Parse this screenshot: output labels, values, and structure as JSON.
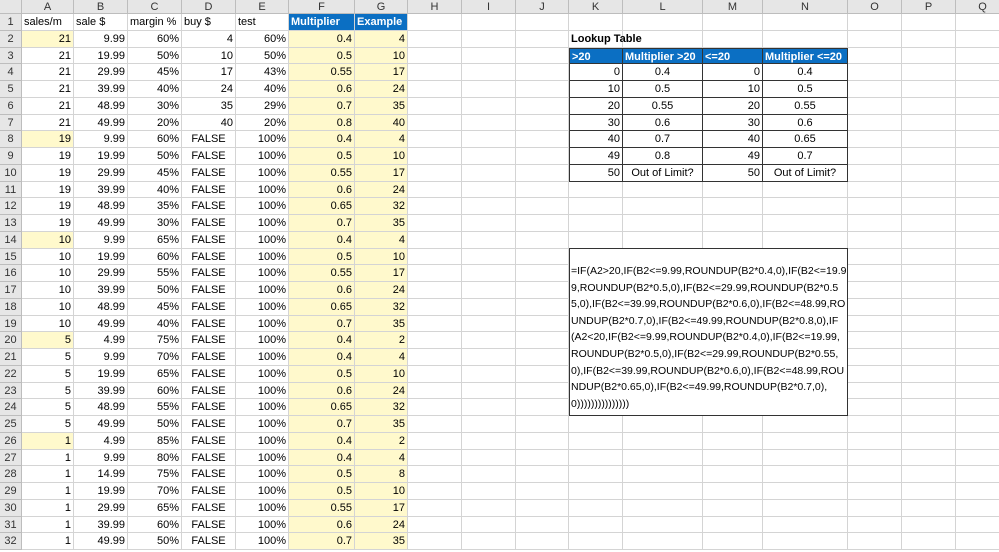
{
  "columns": [
    "A",
    "B",
    "C",
    "D",
    "E",
    "F",
    "G",
    "H",
    "I",
    "J",
    "K",
    "L",
    "M",
    "N",
    "O",
    "P",
    "Q"
  ],
  "headers": [
    "sales/m",
    "sale $",
    "margin %",
    "buy $",
    "test",
    "Multiplier",
    "Example"
  ],
  "rows": [
    [
      "21",
      "9.99",
      "60%",
      "4",
      "60%",
      "0.4",
      "4"
    ],
    [
      "21",
      "19.99",
      "50%",
      "10",
      "50%",
      "0.5",
      "10"
    ],
    [
      "21",
      "29.99",
      "45%",
      "17",
      "43%",
      "0.55",
      "17"
    ],
    [
      "21",
      "39.99",
      "40%",
      "24",
      "40%",
      "0.6",
      "24"
    ],
    [
      "21",
      "48.99",
      "30%",
      "35",
      "29%",
      "0.7",
      "35"
    ],
    [
      "21",
      "49.99",
      "20%",
      "40",
      "20%",
      "0.8",
      "40"
    ],
    [
      "19",
      "9.99",
      "60%",
      "FALSE",
      "100%",
      "0.4",
      "4"
    ],
    [
      "19",
      "19.99",
      "50%",
      "FALSE",
      "100%",
      "0.5",
      "10"
    ],
    [
      "19",
      "29.99",
      "45%",
      "FALSE",
      "100%",
      "0.55",
      "17"
    ],
    [
      "19",
      "39.99",
      "40%",
      "FALSE",
      "100%",
      "0.6",
      "24"
    ],
    [
      "19",
      "48.99",
      "35%",
      "FALSE",
      "100%",
      "0.65",
      "32"
    ],
    [
      "19",
      "49.99",
      "30%",
      "FALSE",
      "100%",
      "0.7",
      "35"
    ],
    [
      "10",
      "9.99",
      "65%",
      "FALSE",
      "100%",
      "0.4",
      "4"
    ],
    [
      "10",
      "19.99",
      "60%",
      "FALSE",
      "100%",
      "0.5",
      "10"
    ],
    [
      "10",
      "29.99",
      "55%",
      "FALSE",
      "100%",
      "0.55",
      "17"
    ],
    [
      "10",
      "39.99",
      "50%",
      "FALSE",
      "100%",
      "0.6",
      "24"
    ],
    [
      "10",
      "48.99",
      "45%",
      "FALSE",
      "100%",
      "0.65",
      "32"
    ],
    [
      "10",
      "49.99",
      "40%",
      "FALSE",
      "100%",
      "0.7",
      "35"
    ],
    [
      "5",
      "4.99",
      "75%",
      "FALSE",
      "100%",
      "0.4",
      "2"
    ],
    [
      "5",
      "9.99",
      "70%",
      "FALSE",
      "100%",
      "0.4",
      "4"
    ],
    [
      "5",
      "19.99",
      "65%",
      "FALSE",
      "100%",
      "0.5",
      "10"
    ],
    [
      "5",
      "39.99",
      "60%",
      "FALSE",
      "100%",
      "0.6",
      "24"
    ],
    [
      "5",
      "48.99",
      "55%",
      "FALSE",
      "100%",
      "0.65",
      "32"
    ],
    [
      "5",
      "49.99",
      "50%",
      "FALSE",
      "100%",
      "0.7",
      "35"
    ],
    [
      "1",
      "4.99",
      "85%",
      "FALSE",
      "100%",
      "0.4",
      "2"
    ],
    [
      "1",
      "9.99",
      "80%",
      "FALSE",
      "100%",
      "0.4",
      "4"
    ],
    [
      "1",
      "14.99",
      "75%",
      "FALSE",
      "100%",
      "0.5",
      "8"
    ],
    [
      "1",
      "19.99",
      "70%",
      "FALSE",
      "100%",
      "0.5",
      "10"
    ],
    [
      "1",
      "29.99",
      "65%",
      "FALSE",
      "100%",
      "0.55",
      "17"
    ],
    [
      "1",
      "39.99",
      "60%",
      "FALSE",
      "100%",
      "0.6",
      "24"
    ],
    [
      "1",
      "49.99",
      "50%",
      "FALSE",
      "100%",
      "0.7",
      "35"
    ]
  ],
  "highlighted_sales_rows": [
    2,
    8,
    14,
    20,
    26
  ],
  "lookup": {
    "title": "Lookup Table",
    "headers": [
      ">20",
      "Multiplier >20",
      "<=20",
      "Multiplier <=20"
    ],
    "rows": [
      [
        "0",
        "0.4",
        "0",
        "0.4"
      ],
      [
        "10",
        "0.5",
        "10",
        "0.5"
      ],
      [
        "20",
        "0.55",
        "20",
        "0.55"
      ],
      [
        "30",
        "0.6",
        "30",
        "0.6"
      ],
      [
        "40",
        "0.7",
        "40",
        "0.65"
      ],
      [
        "49",
        "0.8",
        "49",
        "0.7"
      ],
      [
        "50",
        "Out of Limit?",
        "50",
        "Out of Limit?"
      ]
    ]
  },
  "formula": "=IF(A2>20,IF(B2<=9.99,ROUNDUP(B2*0.4,0),IF(B2<=19.99,ROUNDUP(B2*0.5,0),IF(B2<=29.99,ROUNDUP(B2*0.55,0),IF(B2<=39.99,ROUNDUP(B2*0.6,0),IF(B2<=48.99,ROUNDUP(B2*0.7,0),IF(B2<=49.99,ROUNDUP(B2*0.8,0),IF(A2<20,IF(B2<=9.99,ROUNDUP(B2*0.4,0),IF(B2<=19.99,ROUNDUP(B2*0.5,0),IF(B2<=29.99,ROUNDUP(B2*0.55,0),IF(B2<=39.99,ROUNDUP(B2*0.6,0),IF(B2<=48.99,ROUNDUP(B2*0.65,0),IF(B2<=49.99,ROUNDUP(B2*0.7,0),0)))))))))))))))",
  "colors": {
    "header_blue": "#0b6fc3",
    "highlight_yellow": "#fff9cc"
  }
}
